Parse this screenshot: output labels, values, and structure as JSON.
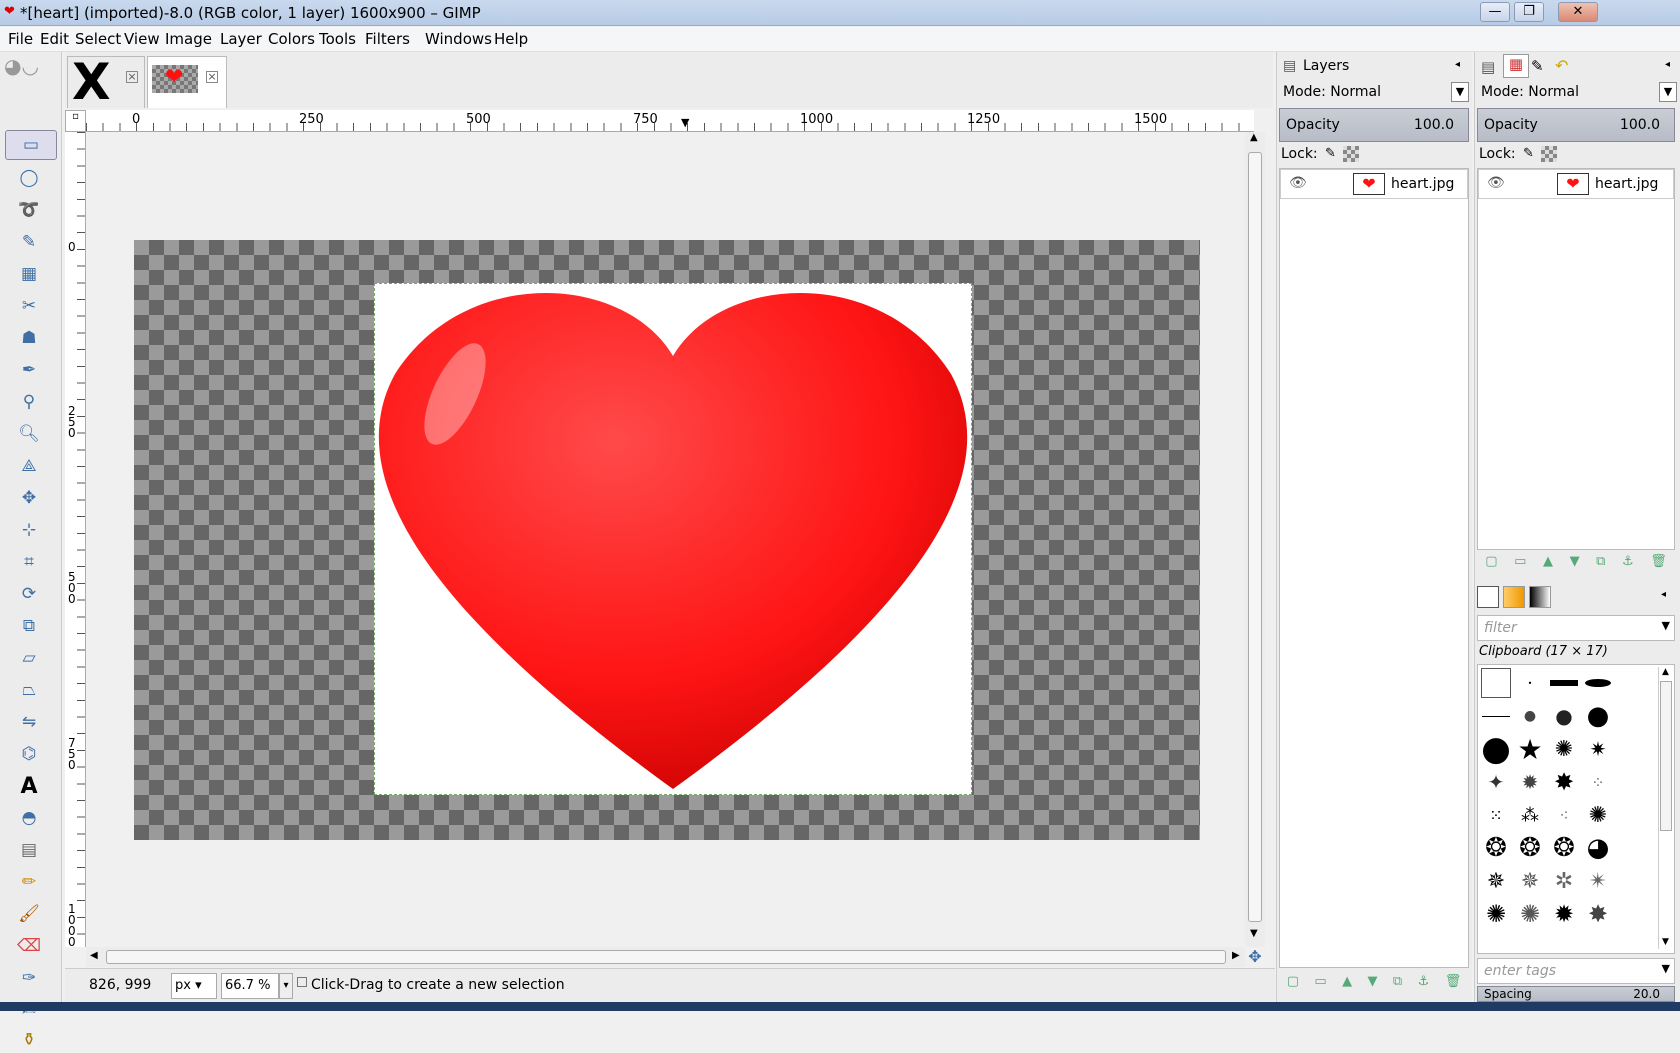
{
  "window": {
    "title": "*[heart] (imported)-8.0 (RGB color, 1 layer) 1600x900 – GIMP",
    "minimize": "—",
    "maximize": "❐",
    "close": "✕"
  },
  "menu": [
    "File",
    "Edit",
    "Select",
    "View",
    "Image",
    "Layer",
    "Colors",
    "Tools",
    "Filters",
    "Windows",
    "Help"
  ],
  "image_tabs": [
    {
      "name": "x-image-tab",
      "glyph": "X"
    },
    {
      "name": "heart-image-tab",
      "glyph": "❤"
    }
  ],
  "ruler_top_labels": [
    "0",
    "250",
    "500",
    "750",
    "1000",
    "1250",
    "1500"
  ],
  "ruler_left_labels": [
    "0",
    "2\n5\n0",
    "5\n0\n0",
    "7\n5\n0",
    "1\n0\n0\n0"
  ],
  "status": {
    "coords": "826, 999",
    "unit": "px",
    "zoom": "66.7 %",
    "hint": "Click-Drag to create a new selection"
  },
  "layers_panel": {
    "title": "Layers",
    "mode_label": "Mode: Normal",
    "opacity_label": "Opacity",
    "opacity_value": "100.0",
    "lock_label": "Lock:",
    "layer_name": "heart.jpg"
  },
  "right_panel": {
    "mode_label": "Mode: Normal",
    "opacity_label": "Opacity",
    "opacity_value": "100.0",
    "lock_label": "Lock:",
    "layer_name": "heart.jpg"
  },
  "brushes_panel": {
    "filter_placeholder": "filter",
    "brush_title": "Clipboard (17 × 17)",
    "tags_placeholder": "enter tags",
    "spacing_label": "Spacing",
    "spacing_value": "20.0"
  },
  "heart_color": "#ff1a1a",
  "tools": [
    "rect-select-icon",
    "ellipse-select-icon",
    "free-select-icon",
    "fuzzy-select-icon",
    "color-select-icon",
    "scissors-icon",
    "foreground-select-icon",
    "paths-icon",
    "color-picker-icon",
    "zoom-icon",
    "measure-icon",
    "move-icon",
    "align-icon",
    "crop-icon",
    "rotate-icon",
    "scale-icon",
    "shear-icon",
    "perspective-icon",
    "flip-icon",
    "cage-icon",
    "text-icon",
    "bucket-fill-icon",
    "blend-icon",
    "pencil-icon",
    "paintbrush-icon",
    "eraser-icon",
    "airbrush-icon",
    "ink-icon",
    "clone-icon"
  ]
}
